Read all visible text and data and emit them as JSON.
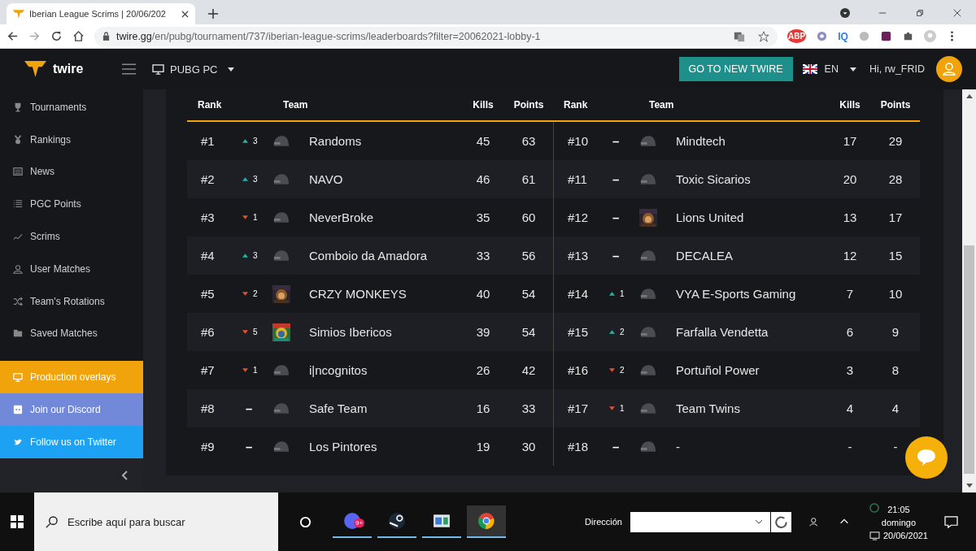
{
  "browser": {
    "tab_title": "Iberian League Scrims | 20/06/202",
    "url_host": "twire.gg",
    "url_path": "/en/pubg/tournament/737/iberian-league-scrims/leaderboards?filter=20062021-lobby-1",
    "extensions": [
      "ABP",
      "IQ"
    ]
  },
  "header": {
    "logo": "twire",
    "platform": "PUBG PC",
    "cta": "GO TO NEW TWIRE",
    "language": "EN",
    "greeting": "Hi, rw_FRID"
  },
  "sidebar": {
    "items": [
      {
        "kind": "trophy",
        "label": "Tournaments"
      },
      {
        "kind": "medal",
        "label": "Rankings"
      },
      {
        "kind": "news",
        "label": "News"
      },
      {
        "kind": "list",
        "label": "PGC Points"
      },
      {
        "kind": "trend",
        "label": "Scrims"
      },
      {
        "kind": "user",
        "label": "User Matches"
      },
      {
        "kind": "shuffle",
        "label": "Team's Rotations"
      },
      {
        "kind": "folder",
        "label": "Saved Matches"
      }
    ],
    "promos": [
      {
        "kind": "monitor",
        "label": "Production overlays",
        "color": "#f0a30a"
      },
      {
        "kind": "discord",
        "label": "Join our Discord",
        "color": "#7289da"
      },
      {
        "kind": "bird",
        "label": "Follow us on Twitter",
        "color": "#1da1f2"
      }
    ]
  },
  "leaderboard": {
    "halves": [
      {
        "columns": [
          "Rank",
          "Team",
          "Kills",
          "Points"
        ],
        "rows": [
          {
            "rank": "#1",
            "up": true,
            "down": false,
            "change": "3",
            "kind": "helmet",
            "team": "Randoms",
            "kills": "45",
            "points": "63"
          },
          {
            "rank": "#2",
            "up": true,
            "down": false,
            "change": "3",
            "kind": "helmet",
            "team": "NAVO",
            "kills": "46",
            "points": "61"
          },
          {
            "rank": "#3",
            "up": false,
            "down": true,
            "change": "1",
            "kind": "helmet",
            "team": "NeverBroke",
            "kills": "35",
            "points": "60"
          },
          {
            "rank": "#4",
            "up": true,
            "down": false,
            "change": "3",
            "kind": "helmet",
            "team": "Comboio da Amadora",
            "kills": "33",
            "points": "56"
          },
          {
            "rank": "#5",
            "up": false,
            "down": true,
            "change": "2",
            "kind": "picture",
            "team": "CRZY MONKEYS",
            "kills": "40",
            "points": "54"
          },
          {
            "rank": "#6",
            "up": false,
            "down": true,
            "change": "5",
            "kind": "picture",
            "team": "Simios Ibericos",
            "kills": "39",
            "points": "54"
          },
          {
            "rank": "#7",
            "up": false,
            "down": true,
            "change": "1",
            "kind": "helmet",
            "team": "i|ncognitos",
            "kills": "26",
            "points": "42"
          },
          {
            "rank": "#8",
            "up": false,
            "down": false,
            "change": "–",
            "kind": "helmet",
            "team": "Safe Team",
            "kills": "16",
            "points": "33"
          },
          {
            "rank": "#9",
            "up": false,
            "down": false,
            "change": "–",
            "kind": "helmet",
            "team": "Los Pintores",
            "kills": "19",
            "points": "30"
          }
        ]
      },
      {
        "columns": [
          "Rank",
          "Team",
          "Kills",
          "Points"
        ],
        "rows": [
          {
            "rank": "#10",
            "up": false,
            "down": false,
            "change": "–",
            "kind": "helmet",
            "team": "Mindtech",
            "kills": "17",
            "points": "29"
          },
          {
            "rank": "#11",
            "up": false,
            "down": false,
            "change": "–",
            "kind": "helmet",
            "team": "Toxic Sicarios",
            "kills": "20",
            "points": "28"
          },
          {
            "rank": "#12",
            "up": false,
            "down": false,
            "change": "–",
            "kind": "picture",
            "team": "Lions United",
            "kills": "13",
            "points": "17"
          },
          {
            "rank": "#13",
            "up": false,
            "down": false,
            "change": "–",
            "kind": "helmet",
            "team": "DECALEA",
            "kills": "12",
            "points": "15"
          },
          {
            "rank": "#14",
            "up": true,
            "down": false,
            "change": "1",
            "kind": "helmet",
            "team": "VYA E-Sports Gaming",
            "kills": "7",
            "points": "10"
          },
          {
            "rank": "#15",
            "up": true,
            "down": false,
            "change": "2",
            "kind": "helmet",
            "team": "Farfalla Vendetta",
            "kills": "6",
            "points": "9"
          },
          {
            "rank": "#16",
            "up": false,
            "down": true,
            "change": "2",
            "kind": "helmet",
            "team": "Portuñol Power",
            "kills": "3",
            "points": "8"
          },
          {
            "rank": "#17",
            "up": false,
            "down": true,
            "change": "1",
            "kind": "helmet",
            "team": "Team Twins",
            "kills": "4",
            "points": "4"
          },
          {
            "rank": "#18",
            "up": false,
            "down": false,
            "change": "–",
            "kind": "helmet",
            "team": "-",
            "kills": "-",
            "points": "-"
          }
        ]
      }
    ]
  },
  "taskbar": {
    "search_placeholder": "Escribe aquí para buscar",
    "app_badge": "9+",
    "address_label": "Dirección",
    "time": "21:05",
    "day": "domingo",
    "date": "20/06/2021"
  }
}
